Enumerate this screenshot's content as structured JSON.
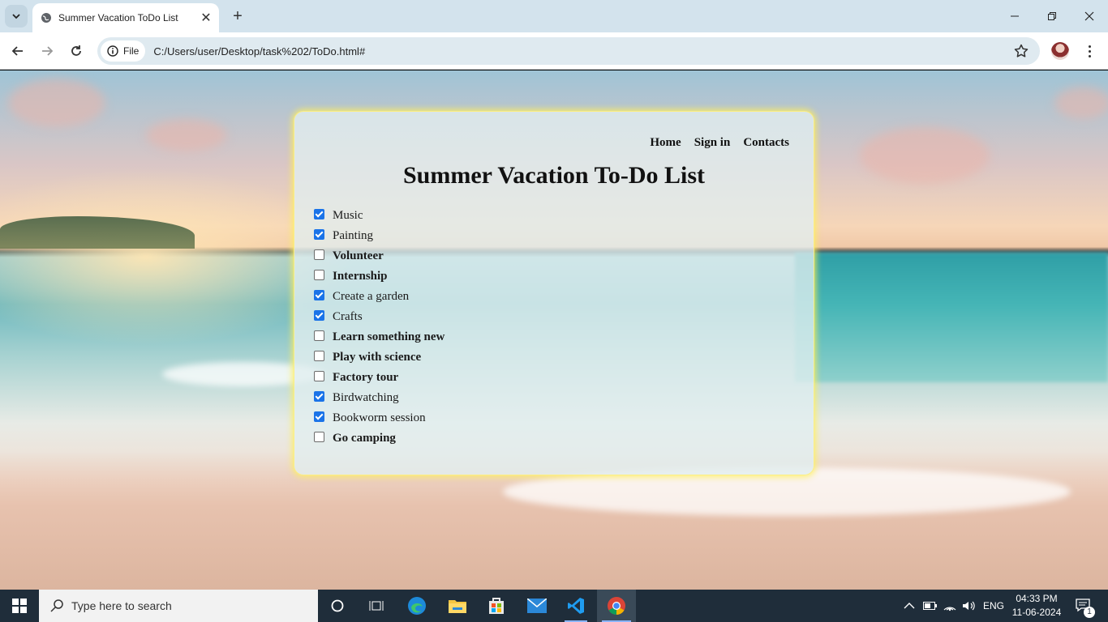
{
  "browser": {
    "tab_title": "Summer Vacation ToDo List",
    "site_chip": "File",
    "url": "C:/Users/user/Desktop/task%202/ToDo.html#"
  },
  "page": {
    "nav": {
      "home": "Home",
      "signin": "Sign in",
      "contacts": "Contacts"
    },
    "title": "Summer Vacation To-Do List",
    "todos": [
      {
        "label": "Music",
        "checked": true
      },
      {
        "label": "Painting",
        "checked": true
      },
      {
        "label": "Volunteer",
        "checked": false
      },
      {
        "label": "Internship",
        "checked": false
      },
      {
        "label": "Create a garden",
        "checked": true
      },
      {
        "label": "Crafts",
        "checked": true
      },
      {
        "label": "Learn something new",
        "checked": false
      },
      {
        "label": "Play with science",
        "checked": false
      },
      {
        "label": "Factory tour",
        "checked": false
      },
      {
        "label": "Birdwatching",
        "checked": true
      },
      {
        "label": "Bookworm session",
        "checked": true
      },
      {
        "label": "Go camping",
        "checked": false
      }
    ]
  },
  "taskbar": {
    "search_placeholder": "Type here to search",
    "language": "ENG",
    "time": "04:33 PM",
    "date": "11-06-2024",
    "notification_count": "1"
  },
  "colors": {
    "accent": "#1a73e8",
    "card_glow": "#fff05a",
    "taskbar": "#1f2d3a"
  }
}
